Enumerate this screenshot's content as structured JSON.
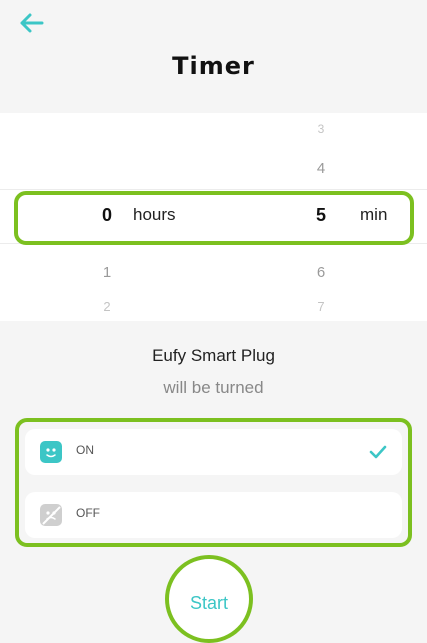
{
  "header": {
    "title": "Timer",
    "back_icon": "back-arrow-icon"
  },
  "picker": {
    "hours": {
      "selected": "0",
      "unit": "hours",
      "below": [
        "1",
        "2"
      ]
    },
    "minutes": {
      "selected": "5",
      "unit": "min",
      "above": [
        "3",
        "4"
      ],
      "below": [
        "6",
        "7"
      ]
    }
  },
  "device": {
    "name": "Eufy Smart Plug",
    "subtitle": "will be turned"
  },
  "options": [
    {
      "label": "ON",
      "icon": "plug-on-icon",
      "selected": true
    },
    {
      "label": "OFF",
      "icon": "plug-off-icon",
      "selected": false
    }
  ],
  "start_label": "Start",
  "colors": {
    "accent": "#3cc6c6",
    "highlight": "#7cc020"
  }
}
